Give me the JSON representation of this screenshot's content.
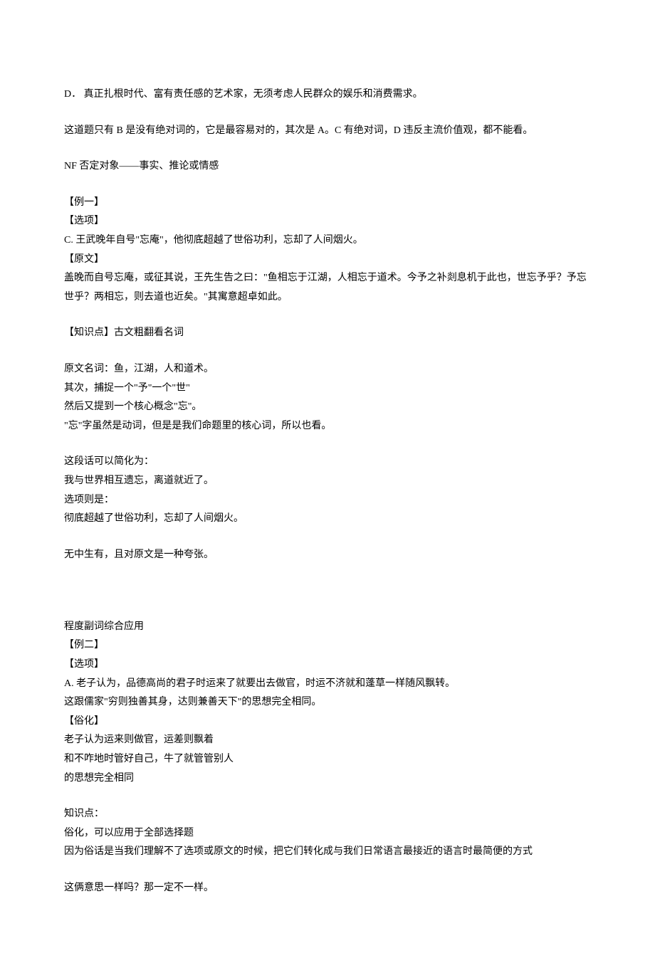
{
  "line1": "D．   真正扎根时代、富有责任感的艺术家，无须考虑人民群众的娱乐和消费需求。",
  "line2": "这道题只有 B 是没有绝对词的，它是最容易对的，其次是 A。C 有绝对词，D 违反主流价值观，都不能看。",
  "line3": "NF 否定对象——事实、推论或情感",
  "ex1_title": "【例一】",
  "ex1_opt": "【选项】",
  "ex1_c": "C. 王武晚年自号\"忘庵\"，他彻底超越了世俗功利，忘却了人间烟火。",
  "ex1_orig": "【原文】",
  "ex1_origtext": "盖晚而自号忘庵，或征其说，王先生告之曰：\"鱼相忘于江湖，人相忘于道术。今予之补剡息机于此也，世忘予乎？予忘世乎？两相忘，则去道也近矣。\"其寓意超卓如此。",
  "kp": "【知识点】古文粗翻看名词",
  "n1": "原文名词：鱼，江湖，人和道术。",
  "n2": "其次，捕捉一个\"予\"一个\"世\"",
  "n3": "然后又提到一个核心概念\"忘\"。",
  "n4": "\"忘\"字虽然是动词，但是是我们命题里的核心词，所以也看。",
  "s1": "这段话可以简化为：",
  "s2": "我与世界相互遗忘，离道就近了。",
  "s3": "选项则是：",
  "s4": "彻底超越了世俗功利，忘却了人间烟火。",
  "conclusion1": "无中生有，且对原文是一种夸张。",
  "adv_title": "程度副词综合应用",
  "ex2_title": "【例二】",
  "ex2_opt": "【选项】",
  "ex2_a1": "A. 老子认为，品德高尚的君子时运来了就要出去做官，时运不济就和蓬草一样随风飘转。",
  "ex2_a2": "这跟儒家\"穷则独善其身，达则兼善天下\"的思想完全相同。",
  "suhua": "【俗化】",
  "su1": "老子认为运来则做官，运差则飘着",
  "su2": "和不咋地时管好自己，牛了就管管别人",
  "su3": "的思想完全相同",
  "kp2_title": "知识点：",
  "kp2_1": "俗化，可以应用于全部选择题",
  "kp2_2": "因为俗话是当我们理解不了选项或原文的时候，把它们转化成与我们日常语言最接近的语言时最简便的方式",
  "final": "这俩意思一样吗？那一定不一样。"
}
